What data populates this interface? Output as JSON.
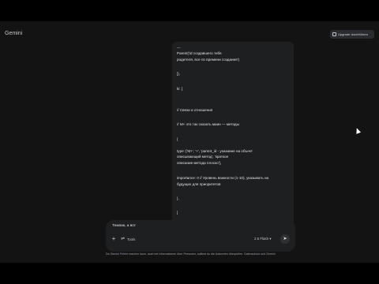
{
  "app": {
    "title": "Gemini",
    "upgrade_label": "Upgrade durchführen"
  },
  "response": {
    "lines": [
      "---",
      "Parent('id создавшего тебя",
      "родителя, все по времени создания')",
      "]),",
      "ki: [",
      "// Связи и отношения",
      "// M+ это так сказать маин — методы",
      "{",
      "type: ['M+', '+', 'parent_id - указание на объект",
      "описывающий метод', 'краткое",
      "описание метода плоско'],",
      "importance: 0 // Уровень важности (1-10), указывать на",
      "будущих для приоритетов",
      "},",
      "]"
    ]
  },
  "prompt": {
    "text": "Темпик, а вот",
    "tools_label": "Tools",
    "model_label": "2.5 Flash ▾"
  },
  "footer": {
    "disclaimer": "Da Gemini Fehler machen kann, auch bei Informationen über Personen, solltest du die Antworten überprüfen. Datenschutz und Gemini"
  }
}
